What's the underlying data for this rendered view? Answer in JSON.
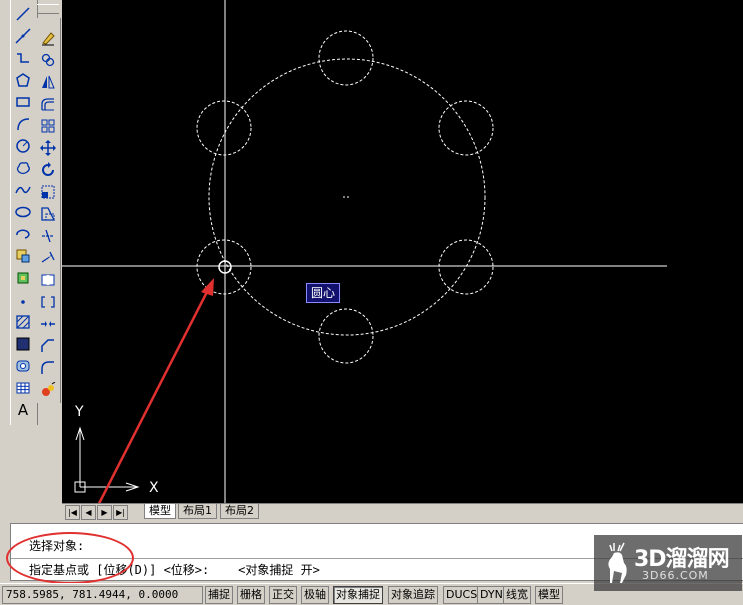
{
  "colors": {
    "canvas": "#000000",
    "crosshair": "#ffffff",
    "dashed": "#ffffff",
    "tooltip_bg": "#12126e",
    "annotation": "#e03030"
  },
  "draw_tools": [
    "line-icon",
    "construction-line-icon",
    "polyline-icon",
    "polygon-icon",
    "rectangle-icon",
    "arc-icon",
    "circle-icon",
    "revision-cloud-icon",
    "spline-icon",
    "ellipse-icon",
    "ellipse-arc-icon",
    "insert-block-icon",
    "make-block-icon",
    "point-icon",
    "hatch-icon",
    "gradient-icon",
    "region-icon",
    "table-icon"
  ],
  "draw_text_tool": "A",
  "modify_tools": [
    "erase-icon",
    "copy-icon",
    "mirror-icon",
    "offset-icon",
    "array-icon",
    "move-icon",
    "rotate-icon",
    "scale-icon",
    "stretch-icon",
    "trim-icon",
    "extend-icon",
    "break-at-point-icon",
    "break-icon",
    "join-icon",
    "chamfer-icon",
    "fillet-icon",
    "explode-icon"
  ],
  "axes": {
    "x_label": "X",
    "y_label": "Y"
  },
  "snap_tooltip": "圆心",
  "tabs": [
    "模型",
    "布局1",
    "布局2"
  ],
  "nav_buttons": [
    "|◀",
    "◀",
    "▶",
    "▶|"
  ],
  "command": {
    "line1": "选择对象:",
    "line2": "指定基点或 [位移(D)] <位移>:    <对象捕捉 开>"
  },
  "status": {
    "coords": "758.5985, 781.4944, 0.0000",
    "buttons": [
      {
        "label": "捕捉",
        "on": false
      },
      {
        "label": "栅格",
        "on": false
      },
      {
        "label": "正交",
        "on": false
      },
      {
        "label": "极轴",
        "on": false
      },
      {
        "label": "对象捕捉",
        "on": true
      },
      {
        "label": "对象追踪",
        "on": false
      },
      {
        "label": "DUCS",
        "on": false
      },
      {
        "label": "DYN",
        "on": false
      },
      {
        "label": "线宽",
        "on": false
      },
      {
        "label": "模型",
        "on": false
      }
    ]
  },
  "watermark": {
    "brand": "3D溜溜网",
    "url": "3D66.COM"
  }
}
